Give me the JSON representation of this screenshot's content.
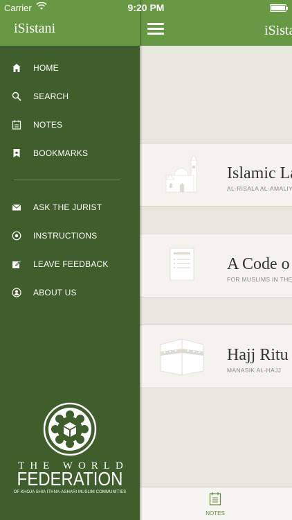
{
  "status_bar": {
    "carrier": "Carrier",
    "time": "9:20 PM"
  },
  "sidebar": {
    "title": "iSistani",
    "items": [
      {
        "label": "HOME",
        "icon": "home-icon"
      },
      {
        "label": "SEARCH",
        "icon": "search-icon"
      },
      {
        "label": "NOTES",
        "icon": "notes-icon"
      },
      {
        "label": "BOOKMARKS",
        "icon": "bookmark-icon"
      }
    ],
    "secondary_items": [
      {
        "label": "ASK THE JURIST",
        "icon": "envelope-icon"
      },
      {
        "label": "INSTRUCTIONS",
        "icon": "target-icon"
      },
      {
        "label": "LEAVE FEEDBACK",
        "icon": "edit-icon"
      },
      {
        "label": "ABOUT US",
        "icon": "person-icon"
      }
    ],
    "logo": {
      "line1": "THE WORLD",
      "line2": "FEDERATION",
      "line3": "OF KHOJA SHIA ITHNA-ASHARI MUSLIM COMMUNITIES"
    }
  },
  "main": {
    "title": "iSistani",
    "books": [
      {
        "title": "Islamic La",
        "subtitle": "AL-RISALA AL-AMALIYY",
        "icon": "mosque-icon"
      },
      {
        "title": "A Code o",
        "subtitle": "FOR MUSLIMS IN THE W",
        "icon": "document-icon"
      },
      {
        "title": "Hajj Ritu",
        "subtitle": "MANASIK AL-HAJJ",
        "icon": "kaaba-icon"
      }
    ],
    "tab_bar": {
      "notes_label": "NOTES"
    }
  },
  "colors": {
    "header_green": "#679843",
    "sidebar_dark": "#3f5e2c",
    "content_bg": "#e9e8df"
  }
}
